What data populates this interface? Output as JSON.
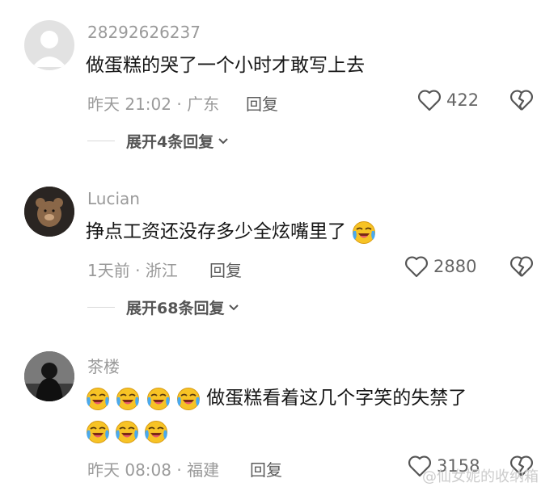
{
  "comments": [
    {
      "username": "28292626237",
      "content": "做蛋糕的哭了一个小时才敢写上去",
      "meta": "昨天 21:02 · 广东",
      "reply_label": "回复",
      "likes": "422",
      "expand_label": "展开4条回复"
    },
    {
      "username": "Lucian",
      "content": "挣点工资还没存多少全炫嘴里了",
      "meta": "1天前 · 浙江",
      "reply_label": "回复",
      "likes": "2880",
      "expand_label": "展开68条回复"
    },
    {
      "username": "茶楼",
      "content": "做蛋糕看着这几个字笑的失禁了",
      "meta": "昨天 08:08 · 福建",
      "reply_label": "回复",
      "likes": "3158"
    }
  ],
  "icons": {
    "like": "heart-outline-icon",
    "dislike": "broken-heart-icon",
    "expand": "chevron-down-icon",
    "emoji": "crying-laughing-emoji"
  },
  "watermark": "@仙女妮的收纳箱",
  "colors": {
    "text_primary": "#161616",
    "text_secondary": "#9a9a9a",
    "emoji_yellow": "#f7c325"
  }
}
